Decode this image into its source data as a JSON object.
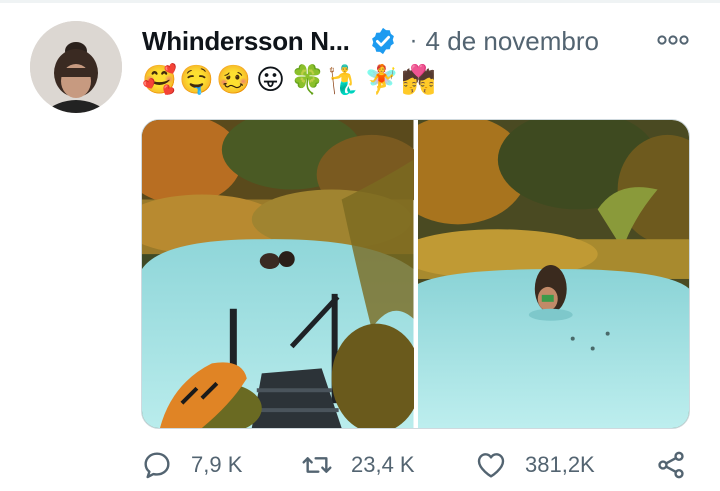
{
  "tweet": {
    "author_name": "Whindersson N...",
    "separator": "·",
    "date": "4 de novembro",
    "emoji_text": [
      "🥰",
      "🤤",
      "🥴",
      "😛",
      "🍀",
      "🧜‍♂️",
      "🧚",
      "💏"
    ],
    "actions": {
      "reply_count": "7,9 K",
      "retweet_count": "23,4 K",
      "like_count": "381,2K"
    }
  },
  "colors": {
    "text_primary": "#0f1419",
    "text_secondary": "#536471",
    "verified": "#1d9bf0",
    "border": "#cfd9de"
  },
  "icons": [
    "verified-badge-icon",
    "more-icon",
    "reply-icon",
    "retweet-icon",
    "like-icon",
    "share-icon"
  ]
}
